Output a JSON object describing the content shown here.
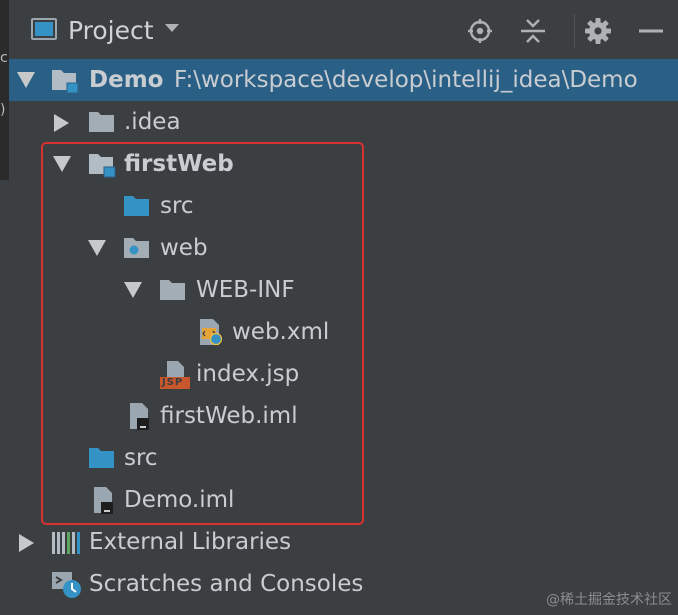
{
  "header": {
    "title": "Project",
    "view_icon": "project-view-icon",
    "dropdown_icon": "chevron-down-icon",
    "buttons": [
      {
        "name": "locate-icon"
      },
      {
        "name": "collapse-all-icon"
      },
      {
        "name": "gear-icon"
      },
      {
        "name": "hide-icon"
      }
    ]
  },
  "left_strip": {
    "glyphs": [
      "c",
      ")"
    ]
  },
  "tree": {
    "root": {
      "label": "Demo",
      "path": "F:\\workspace\\develop\\intellij_idea\\Demo",
      "icon": "module-folder-icon",
      "expanded": true
    },
    "idea": {
      "label": ".idea",
      "icon": "folder-icon",
      "expanded": false
    },
    "firstweb": {
      "label": "firstWeb",
      "icon": "module-folder-icon",
      "expanded": true
    },
    "firstweb_src": {
      "label": "src",
      "icon": "source-folder-icon"
    },
    "web": {
      "label": "web",
      "icon": "web-folder-icon",
      "expanded": true
    },
    "webinf": {
      "label": "WEB-INF",
      "icon": "folder-icon",
      "expanded": true
    },
    "webxml": {
      "label": "web.xml",
      "icon": "xml-file-icon"
    },
    "indexjsp": {
      "label": "index.jsp",
      "icon": "jsp-file-icon",
      "badge": "JSP"
    },
    "firstweb_iml": {
      "label": "firstWeb.iml",
      "icon": "iml-file-icon"
    },
    "src": {
      "label": "src",
      "icon": "source-folder-icon"
    },
    "demo_iml": {
      "label": "Demo.iml",
      "icon": "iml-file-icon"
    },
    "external_libraries": {
      "label": "External Libraries",
      "icon": "libraries-icon",
      "expanded": false
    },
    "scratches": {
      "label": "Scratches and Consoles",
      "icon": "scratches-icon"
    }
  },
  "watermark": "@稀土掘金技术社区",
  "colors": {
    "background": "#3c3f41",
    "selection": "#2a5f86",
    "highlight_border": "#d93030",
    "source_folder": "#3592c4"
  }
}
